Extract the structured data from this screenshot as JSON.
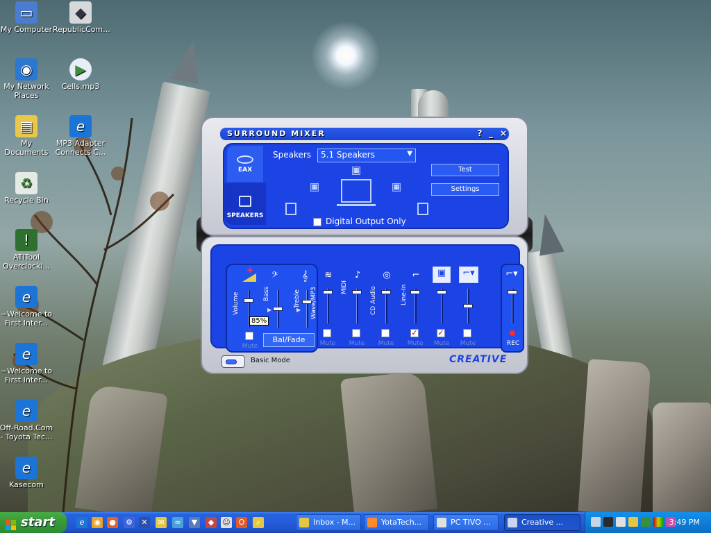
{
  "desktop": {
    "icons": [
      {
        "label": "My Computer",
        "icon": "my-computer-icon",
        "color": "#4a7ccf"
      },
      {
        "label": "RepublicCom...",
        "icon": "republic-icon",
        "color": "#d6d8da"
      },
      {
        "label": "My Network Places",
        "icon": "network-places-icon",
        "color": "#2b78d0"
      },
      {
        "label": "Cells.mp3",
        "icon": "media-file-icon",
        "color": "#3b8f3b"
      },
      {
        "label": "My Documents",
        "icon": "my-documents-icon",
        "color": "#e8c84a"
      },
      {
        "label": "MP3 Adapter Connects C...",
        "icon": "internet-explorer-icon",
        "color": "#1b74d6"
      },
      {
        "label": "Recycle Bin",
        "icon": "recycle-bin-icon",
        "color": "#6ca26c"
      },
      {
        "label": "ATITool Overclocki...",
        "icon": "atitool-icon",
        "color": "#2f6f2f"
      },
      {
        "label": "~Welcome to First Inter...",
        "icon": "internet-explorer-icon",
        "color": "#1b74d6"
      },
      {
        "label": "~Welcome to First Inter...",
        "icon": "internet-explorer-icon",
        "color": "#1b74d6"
      },
      {
        "label": "Off-Road.Com - Toyota Tec...",
        "icon": "internet-explorer-icon",
        "color": "#1b74d6"
      },
      {
        "label": "Kasecom",
        "icon": "internet-explorer-icon",
        "color": "#1b74d6"
      }
    ]
  },
  "mixer": {
    "title": "SURROUND MIXER",
    "help": "?",
    "minimize": "_",
    "close": "×",
    "tabs": {
      "eax": "EAX",
      "speakers": "SPEAKERS"
    },
    "speakers_label": "Speakers",
    "speakers_value": "5.1 Speakers",
    "test_label": "Test",
    "settings_label": "Settings",
    "digital_output_label": "Digital Output Only",
    "master": {
      "volume_label": "Volume",
      "bass_label": "Bass",
      "treble_label": "Treble",
      "volume_value": "85%",
      "mute_label": "Mute",
      "balfade_label": "Bal/Fade"
    },
    "channels": [
      {
        "label": "Wave/MP3",
        "mute": "Mute",
        "muted": false
      },
      {
        "label": "MIDI",
        "mute": "Mute",
        "muted": false
      },
      {
        "label": "CD Audio",
        "mute": "Mute",
        "muted": false
      },
      {
        "label": "Line-In",
        "mute": "Mute",
        "muted": true
      },
      {
        "label": "",
        "mute": "Mute",
        "muted": true
      },
      {
        "label": "",
        "mute": "Mute",
        "muted": false
      }
    ],
    "rec_label": "REC",
    "basic_mode_label": "Basic Mode",
    "brand": "CREATIVE",
    "accent": "#1c44e4"
  },
  "taskbar": {
    "start_label": "start",
    "buttons": [
      {
        "label": "Inbox - M...",
        "color": "#e4c640"
      },
      {
        "label": "YotaTech...",
        "color": "#ff8a2a"
      },
      {
        "label": "PC TIVO ...",
        "color": "#e0e0e0"
      },
      {
        "label": "Creative ...",
        "color": "#c8d4f0"
      }
    ],
    "clock": "3:49 PM"
  }
}
